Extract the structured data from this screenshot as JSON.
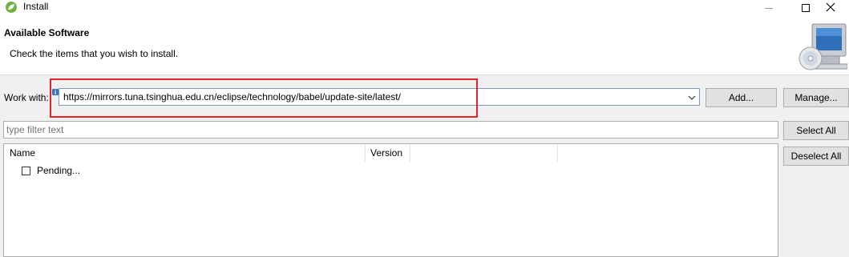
{
  "window": {
    "title": "Install",
    "app_icon": "eclipse-spring-leaf-icon",
    "controls": [
      "minimize-icon",
      "maximize-icon",
      "close-icon"
    ]
  },
  "header": {
    "title": "Available Software",
    "description": "Check the items that you wish to install.",
    "image": "install-wizard-computer-cd-icon"
  },
  "work_with": {
    "label": "Work with:",
    "value": "https://mirrors.tuna.tsinghua.edu.cn/eclipse/technology/babel/update-site/latest/",
    "add_label": "Add...",
    "manage_label": "Manage..."
  },
  "filter": {
    "placeholder": "type filter text"
  },
  "tree": {
    "columns": [
      "Name",
      "Version"
    ],
    "rows": [
      {
        "name": "Pending...",
        "checked": false
      }
    ]
  },
  "actions": {
    "select_all": "Select All",
    "deselect_all": "Deselect All"
  },
  "colors": {
    "highlight": "#e0252b",
    "combo_border": "#7a9cc8"
  }
}
